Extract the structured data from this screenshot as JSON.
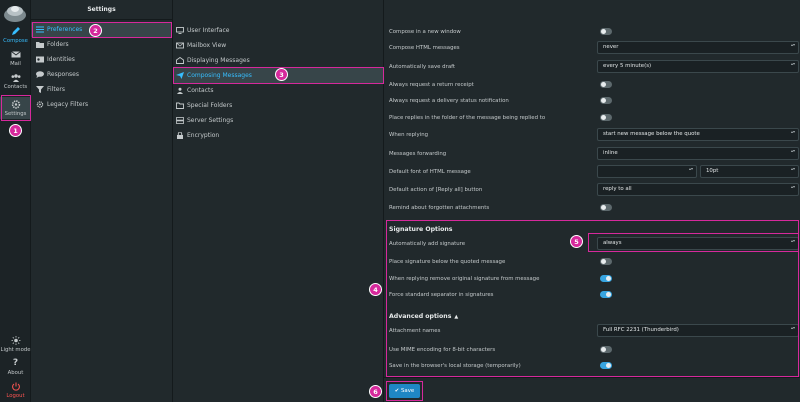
{
  "rail": {
    "compose": "Compose",
    "mail": "Mail",
    "contacts": "Contacts",
    "settings": "Settings",
    "light_mode": "Light mode",
    "about": "About",
    "logout": "Logout"
  },
  "settings_col": {
    "title": "Settings",
    "items": [
      "Preferences",
      "Folders",
      "Identities",
      "Responses",
      "Filters",
      "Legacy Filters"
    ]
  },
  "sections_col": {
    "items": [
      "User Interface",
      "Mailbox View",
      "Displaying Messages",
      "Composing Messages",
      "Contacts",
      "Special Folders",
      "Server Settings",
      "Encryption"
    ]
  },
  "form": {
    "compose_new_window": "Compose in a new window",
    "compose_html": "Compose HTML messages",
    "compose_html_value": "never",
    "autosave": "Automatically save draft",
    "autosave_value": "every 5 minute(s)",
    "return_receipt": "Always request a return receipt",
    "delivery_notification": "Always request a delivery status notification",
    "place_replies": "Place replies in the folder of the message being replied to",
    "when_replying": "When replying",
    "when_replying_value": "start new message below the quote",
    "forwarding": "Messages forwarding",
    "forwarding_value": "inline",
    "default_font": "Default font of HTML message",
    "default_font_size": "10pt",
    "reply_all": "Default action of [Reply all] button",
    "reply_all_value": "reply to all",
    "remind_attachments": "Remind about forgotten attachments",
    "signature_header": "Signature Options",
    "auto_signature": "Automatically add signature",
    "auto_signature_value": "always",
    "sig_below_quote": "Place signature below the quoted message",
    "remove_sig": "When replying remove original signature from message",
    "force_separator": "Force standard separator in signatures",
    "advanced_header": "Advanced options",
    "attachment_names": "Attachment names",
    "attachment_names_value": "Full RFC 2231 (Thunderbird)",
    "mime_encoding": "Use MIME encoding for 8-bit characters",
    "local_storage": "Save in the browser's local storage (temporarily)",
    "save": "Save"
  },
  "badges": [
    "1",
    "2",
    "3",
    "4",
    "5",
    "6"
  ],
  "colors": {
    "accent": "#37beff",
    "annotation": "#d6299c",
    "logout": "#ff5552"
  }
}
